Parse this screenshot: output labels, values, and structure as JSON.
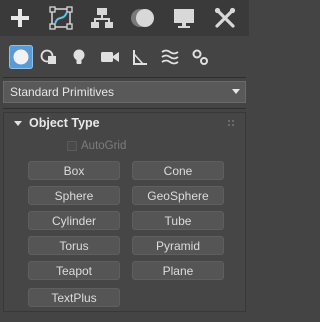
{
  "tabs": [
    {
      "icon": "create-plus-icon"
    },
    {
      "icon": "modify-curve-icon"
    },
    {
      "icon": "hierarchy-icon"
    },
    {
      "icon": "motion-circle-icon"
    },
    {
      "icon": "display-monitor-icon"
    },
    {
      "icon": "utilities-wrench-icon"
    }
  ],
  "subcategories": [
    {
      "icon": "geometry-sphere-icon",
      "active": true
    },
    {
      "icon": "shapes-icon"
    },
    {
      "icon": "lights-icon"
    },
    {
      "icon": "cameras-icon"
    },
    {
      "icon": "helpers-icon"
    },
    {
      "icon": "space-warps-icon"
    },
    {
      "icon": "systems-icon"
    }
  ],
  "dropdown": {
    "selected": "Standard Primitives"
  },
  "rollout": {
    "title": "Object Type",
    "autogrid_label": "AutoGrid",
    "buttons": [
      "Box",
      "Cone",
      "Sphere",
      "GeoSphere",
      "Cylinder",
      "Tube",
      "Torus",
      "Pyramid",
      "Teapot",
      "Plane",
      "TextPlus"
    ]
  },
  "colors": {
    "accent": "#5b9bd5",
    "panel": "#444444",
    "text": "#dcdcdc"
  }
}
